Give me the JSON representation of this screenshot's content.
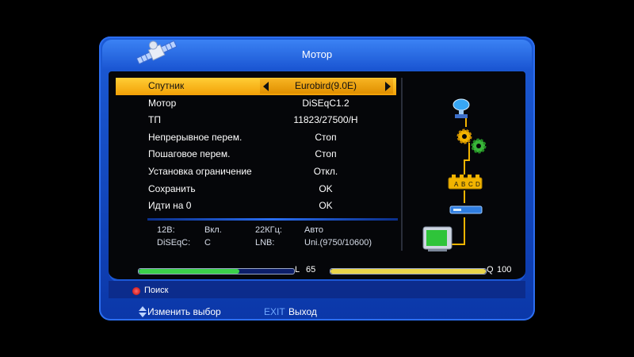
{
  "window": {
    "title": "Мотор"
  },
  "menu": {
    "rows": [
      {
        "label": "Спутник",
        "value": "Eurobird(9.0E)"
      },
      {
        "label": "Мотор",
        "value": "DiSEqC1.2"
      },
      {
        "label": "ТП",
        "value": "11823/27500/H"
      },
      {
        "label": "Непрерывное перем.",
        "value": "Стоп"
      },
      {
        "label": "Пошаговое перем.",
        "value": "Стоп"
      },
      {
        "label": "Установка ограничение",
        "value": "Откл."
      },
      {
        "label": "Сохранить",
        "value": "OK"
      },
      {
        "label": "Идти на 0",
        "value": "OK"
      }
    ]
  },
  "info": {
    "voltage_label": "12В:",
    "voltage_value": "Вкл.",
    "tone_label": "22КГц:",
    "tone_value": "Авто",
    "diseqc_label": "DiSEqC:",
    "diseqc_value": "C",
    "lnb_label": "LNB:",
    "lnb_value": "Uni.(9750/10600)"
  },
  "signal": {
    "level_label": "L",
    "level_value": "65",
    "level_fraction": 0.65,
    "quality_label": "Q",
    "quality_value": "100",
    "quality_fraction": 1.0
  },
  "footer": {
    "search_label": "Поиск",
    "change_label": "Изменить выбор",
    "exit_key": "EXIT",
    "exit_label": "Выход"
  },
  "diagram": {
    "switch_letters": [
      "A",
      "B",
      "C",
      "D"
    ]
  },
  "colors": {
    "accent_blue": "#1c5bd6",
    "selection_yellow": "#f7b422",
    "level_green": "#3bd04a",
    "quality_yellow": "#e8d44a",
    "red_button": "#d40000"
  }
}
